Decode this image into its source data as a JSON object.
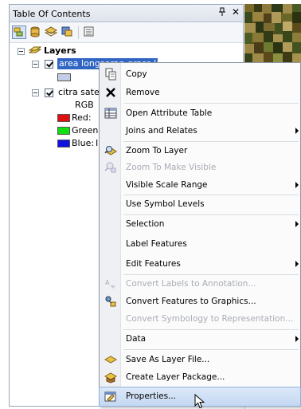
{
  "toc": {
    "title": "Table Of Contents",
    "pin_glyph": "♯",
    "close_glyph": "✕",
    "toolbar_icons": [
      "list-by-drawing-order-icon",
      "list-by-source-icon",
      "list-by-visibility-icon",
      "list-by-selection-icon",
      "options-icon"
    ]
  },
  "tree": {
    "root_label": "Layers",
    "layer1_label": "area longsoran grass lab",
    "layer2_label": "citra sateli",
    "rgb_label": "RGB",
    "red_label": "Red:",
    "green_label": "Green:",
    "blue_label": "Blue:",
    "blue_suffix": "I",
    "colors": {
      "red": "#e01010",
      "green": "#10e010",
      "blue": "#1010e0",
      "poly": "#c4cbe8",
      "selection": "#3165c4"
    }
  },
  "menu": {
    "copy": "Copy",
    "remove": "Remove",
    "open_attribute_table": "Open Attribute Table",
    "joins_and_relates": "Joins and Relates",
    "zoom_to_layer": "Zoom To Layer",
    "zoom_to_make_visible": "Zoom To Make Visible",
    "visible_scale_range": "Visible Scale Range",
    "use_symbol_levels": "Use Symbol Levels",
    "selection": "Selection",
    "label_features": "Label Features",
    "edit_features": "Edit Features",
    "convert_labels": "Convert Labels to Annotation...",
    "convert_features": "Convert Features to Graphics...",
    "convert_symbology": "Convert Symbology to Representation...",
    "data": "Data",
    "save_as_layer_file": "Save As Layer File...",
    "create_layer_package": "Create Layer Package...",
    "properties": "Properties..."
  }
}
